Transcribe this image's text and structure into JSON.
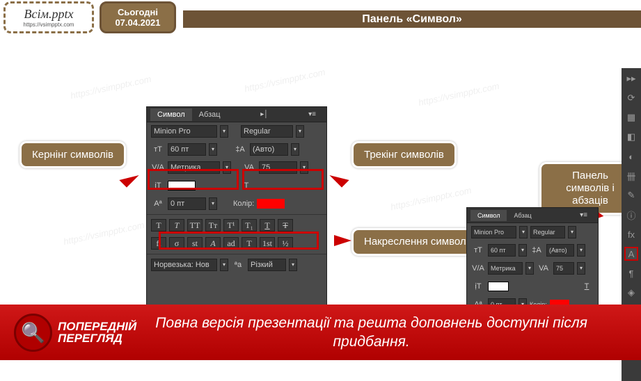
{
  "header": {
    "logo_main": "Всім.pptx",
    "logo_sub": "https://vsimpptx.com",
    "date_label": "Сьогодні",
    "date_value": "07.04.2021",
    "title": "Панель «Символ»"
  },
  "callouts": {
    "kerning": "Кернінг символів",
    "tracking": "Трекінг символів",
    "styles": "Накреслення символів",
    "panel": "Панель символів і абзаців"
  },
  "panel": {
    "tab_symbol": "Символ",
    "tab_paragraph": "Абзац",
    "font_name": "Minion Pro",
    "font_style": "Regular",
    "size": "60 пт",
    "leading": "(Авто)",
    "kerning": "Метрика",
    "tracking": "75",
    "vscale": "0 пт",
    "color_label": "Колір:",
    "lang_label": "Норвезька: Нов",
    "aa_label": "Різкий",
    "style_buttons": [
      "T",
      "T",
      "TT",
      "Tт",
      "T¹",
      "T₁",
      "T",
      "Ŧ"
    ],
    "ot_buttons": [
      "fi",
      "σ",
      "st",
      "A",
      "ad",
      "T",
      "1st",
      "½"
    ]
  },
  "footer": {
    "preview_l1": "ПОПЕРЕДНІЙ",
    "preview_l2": "ПЕРЕГЛЯД",
    "message": "Повна версія презентації та решта доповнень доступні після придбання."
  },
  "watermark": "https://vsimpptx.com"
}
